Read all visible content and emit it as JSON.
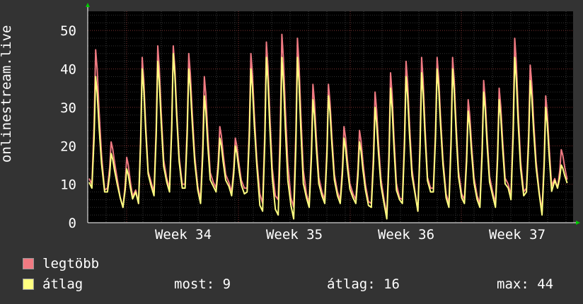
{
  "chart_data": {
    "type": "line",
    "ylabel": "onlinestream.live",
    "ylim": [
      0,
      55
    ],
    "yticks": [
      0,
      10,
      20,
      30,
      40,
      50
    ],
    "xlabels": [
      "Week 34",
      "Week 35",
      "Week 36",
      "Week 37"
    ],
    "series": [
      {
        "name": "legtöbb",
        "color": "#f07a82",
        "peaks": [
          45,
          21,
          17,
          43,
          46,
          46,
          44,
          38,
          25,
          22,
          44,
          47,
          49,
          48,
          36,
          36,
          25,
          24,
          34,
          39,
          42,
          43,
          43,
          43,
          32,
          37,
          35,
          48,
          41,
          33,
          19
        ],
        "troughs": [
          10,
          9,
          4,
          5,
          8,
          9,
          10,
          6,
          9,
          8,
          9,
          5,
          6,
          4,
          5,
          6,
          6,
          6,
          5,
          2,
          6,
          3,
          9,
          5,
          6,
          5,
          5,
          7,
          9,
          3,
          9
        ]
      },
      {
        "name": "átlag",
        "color": "#ffff80",
        "peaks": [
          38,
          18,
          14,
          40,
          42,
          44,
          40,
          33,
          22,
          20,
          40,
          43,
          43,
          43,
          32,
          33,
          22,
          21,
          30,
          35,
          38,
          39,
          40,
          40,
          29,
          34,
          32,
          43,
          37,
          30,
          15
        ],
        "troughs": [
          9,
          8,
          4,
          5,
          7,
          8,
          9,
          5,
          8,
          7,
          8,
          3,
          2,
          1,
          4,
          5,
          5,
          5,
          4,
          1,
          5,
          3,
          8,
          4,
          5,
          4,
          4,
          6,
          8,
          2,
          9
        ]
      }
    ]
  },
  "legend": [
    {
      "label": "legtöbb",
      "color": "#f07a82"
    },
    {
      "label": "átlag",
      "color": "#ffff80"
    }
  ],
  "stats": {
    "now": "most: 9",
    "avg": "átlag: 16",
    "max": "max: 44"
  }
}
